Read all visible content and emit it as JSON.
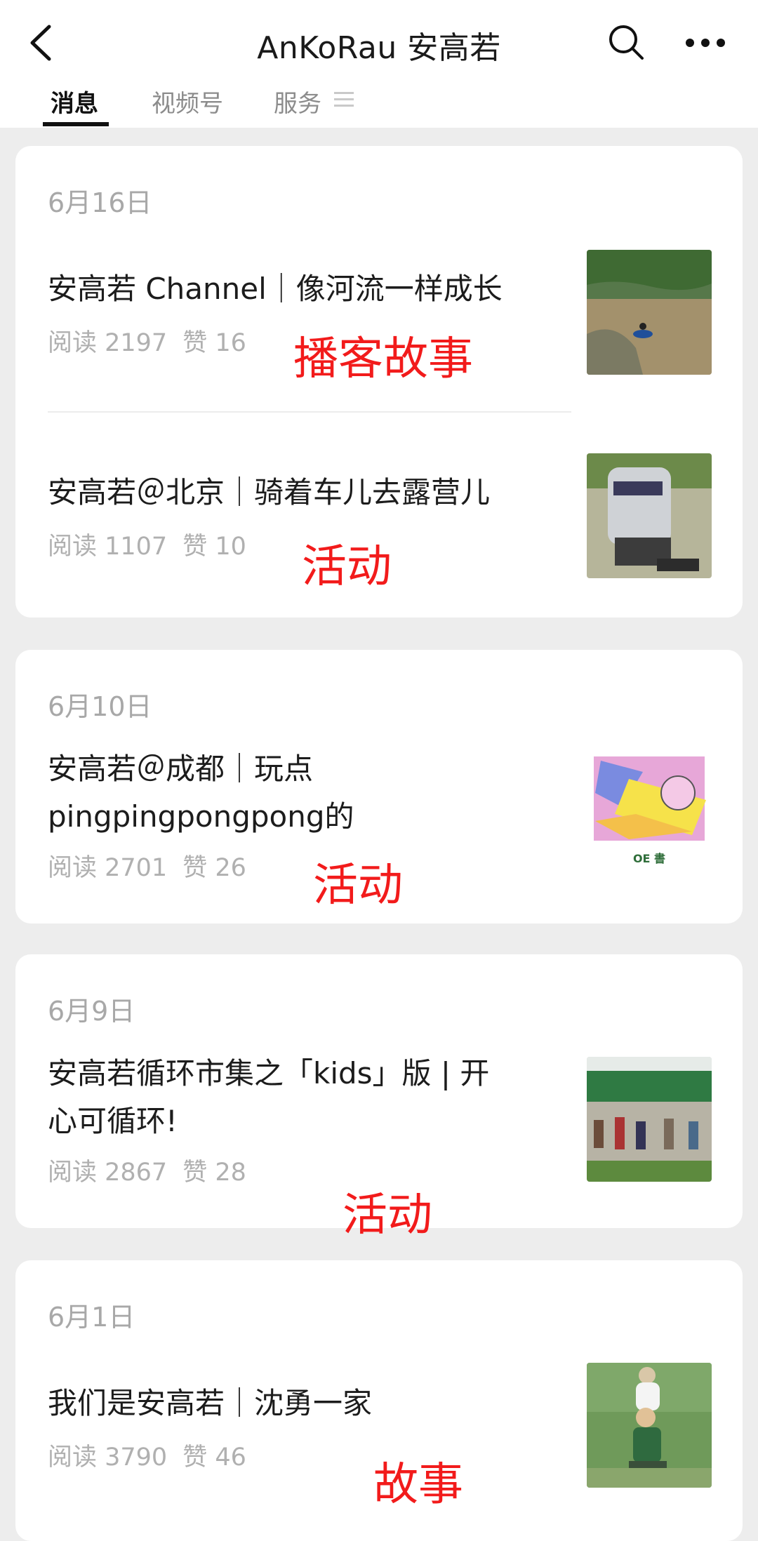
{
  "header": {
    "title": "AnKoRau 安高若",
    "tabs": [
      "消息",
      "视频号",
      "服务"
    ]
  },
  "posts": [
    {
      "date": "6月16日",
      "articles": [
        {
          "title": "安高若 Channel｜像河流一样成长",
          "read": "阅读 2197",
          "likes": "赞 16",
          "annotation": "播客故事"
        },
        {
          "title": "安高若＠北京｜骑着车儿去露营儿",
          "read": "阅读 1107",
          "likes": "赞 10",
          "annotation": "活动"
        }
      ]
    },
    {
      "date": "6月10日",
      "articles": [
        {
          "title_line1": "安高若＠成都｜玩点",
          "title_line2": "pingpingpongpong的",
          "read": "阅读 2701",
          "likes": "赞 26",
          "annotation": "活动"
        }
      ]
    },
    {
      "date": "6月9日",
      "articles": [
        {
          "title_line1": "安高若循环市集之「kids」版 | 开",
          "title_line2": "心可循环!",
          "read": "阅读 2867",
          "likes": "赞 28",
          "annotation": "活动"
        }
      ]
    },
    {
      "date": "6月1日",
      "articles": [
        {
          "title": "我们是安高若｜沈勇一家",
          "read": "阅读 3790",
          "likes": "赞 46",
          "annotation": "故事"
        }
      ]
    }
  ],
  "thumb3_text": "OE 書",
  "colors": {
    "annotation": "#f21b1b",
    "background": "#ededed",
    "card": "#ffffff"
  }
}
